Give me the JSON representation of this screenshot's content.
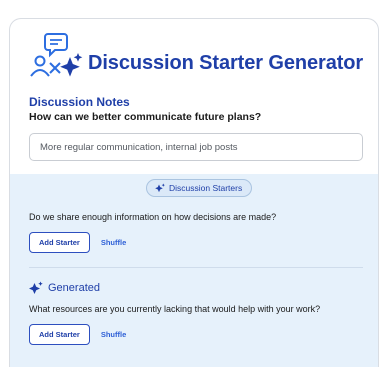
{
  "app": {
    "title": "Discussion Starter Generator",
    "brand_color": "#1f3fa8",
    "logo_icons": [
      "chat-bubble-icon",
      "people-icon",
      "sparkle-icon"
    ]
  },
  "notes": {
    "label": "Discussion Notes",
    "question": "How can we better communicate future plans?",
    "input_value": "More regular communication, internal job posts"
  },
  "starters": {
    "chip_label": "Discussion Starters",
    "items": [
      {
        "question": "Do we share enough information on how decisions are made?",
        "add_label": "Add Starter",
        "shuffle_label": "Shuffle"
      }
    ]
  },
  "generated": {
    "label": "Generated",
    "items": [
      {
        "question": "What resources are you currently lacking that would help with your work?",
        "add_label": "Add Starter",
        "shuffle_label": "Shuffle"
      }
    ]
  }
}
